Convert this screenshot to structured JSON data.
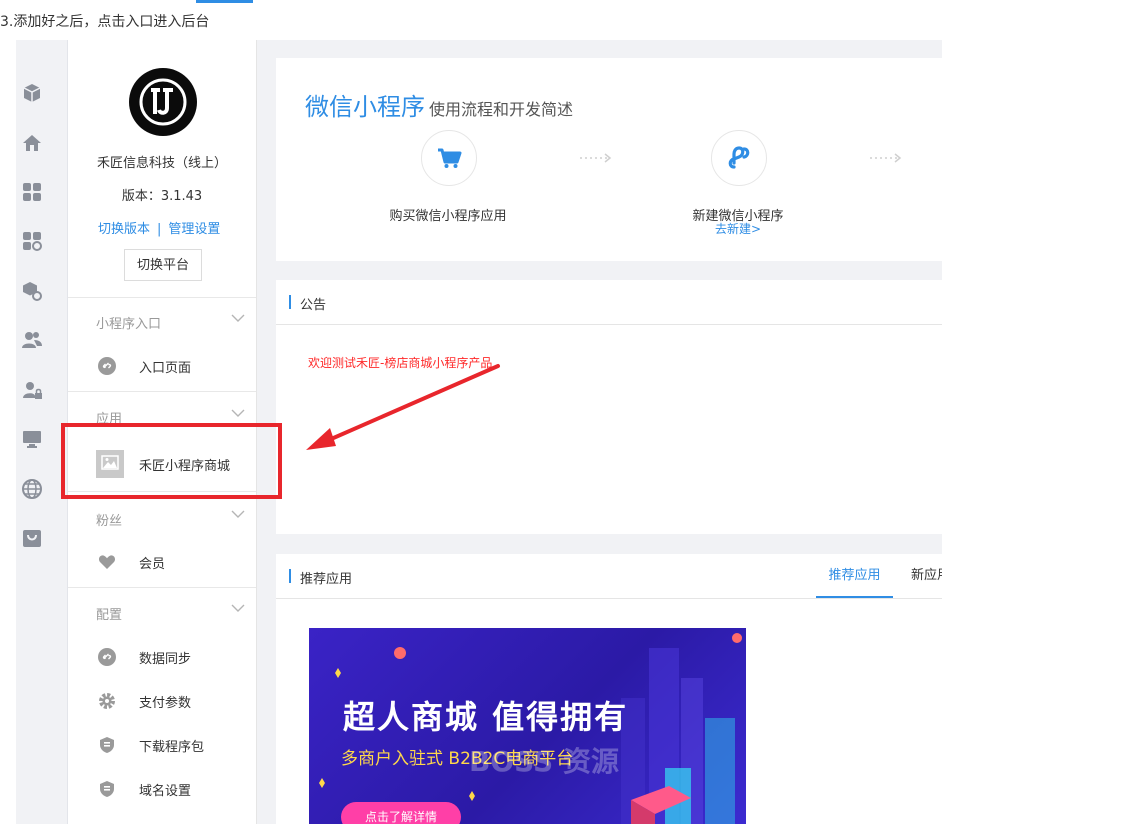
{
  "caption": "3.添加好之后，点击入口进入后台",
  "sidebar": {
    "org_name": "禾匠信息科技（线上）",
    "version": "版本：3.1.43",
    "switch_version": "切换版本",
    "link_separator": "|",
    "manage_settings": "管理设置",
    "switch_platform": "切换平台",
    "sections": [
      {
        "title": "小程序入口",
        "items": [
          {
            "label": "入口页面",
            "icon": "link-icon"
          }
        ]
      },
      {
        "title": "应用",
        "items": [
          {
            "label": "禾匠小程序商城",
            "icon": "image-placeholder-icon"
          }
        ]
      },
      {
        "title": "粉丝",
        "items": [
          {
            "label": "会员",
            "icon": "heart-icon"
          }
        ]
      },
      {
        "title": "配置",
        "items": [
          {
            "label": "数据同步",
            "icon": "link-icon"
          },
          {
            "label": "支付参数",
            "icon": "gear-icon"
          },
          {
            "label": "下载程序包",
            "icon": "shield-icon"
          },
          {
            "label": "域名设置",
            "icon": "shield-icon"
          }
        ]
      }
    ]
  },
  "rail_icons": [
    "cube-icon",
    "home-icon",
    "apps-grid-icon",
    "apps-settings-icon",
    "package-settings-icon",
    "users-icon",
    "user-lock-icon",
    "monitor-icon",
    "globe-icon",
    "shop-bag-icon"
  ],
  "flow": {
    "title": "微信小程序",
    "subtitle": "使用流程和开发简述",
    "steps": [
      {
        "label": "购买微信小程序应用",
        "link": "",
        "icon": "cart-icon"
      },
      {
        "label": "新建微信小程序",
        "link": "去新建>",
        "icon": "mini-program-icon"
      }
    ]
  },
  "notice": {
    "title": "公告",
    "text": "欢迎测试禾匠-榜店商城小程序产品"
  },
  "recommend": {
    "title": "推荐应用",
    "tabs": [
      "推荐应用",
      "新应用"
    ],
    "banner": {
      "headline": "超人商城 值得拥有",
      "subline": "多商户入驻式 B2B2C电商平台",
      "watermark": "BOSS 资源",
      "button": "点击了解详情"
    }
  },
  "colors": {
    "accent": "#2f8de4",
    "annotation": "#e8262c",
    "notice_text": "#ff2a2a"
  }
}
